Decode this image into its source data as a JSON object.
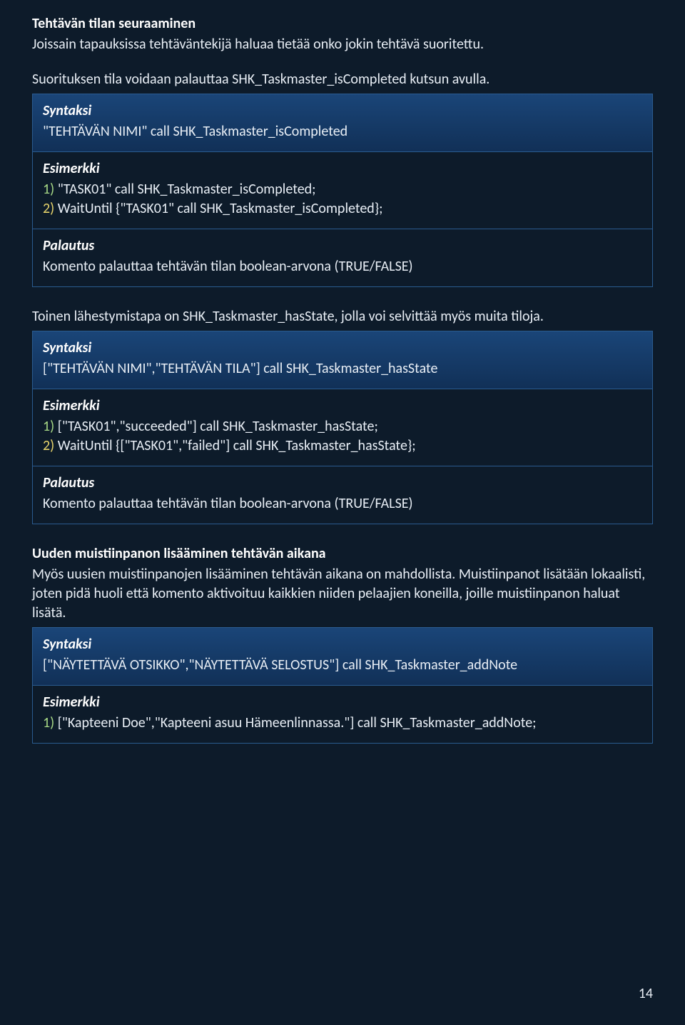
{
  "section1": {
    "heading": "Tehtävän tilan seuraaminen",
    "p1": "Joissain tapauksissa tehtäväntekijä haluaa tietää onko jokin tehtävä suoritettu.",
    "p2": "Suorituksen tila voidaan palauttaa SHK_Taskmaster_isCompleted kutsun avulla."
  },
  "box1": {
    "syntax_label": "Syntaksi",
    "syntax_body": "\"TEHTÄVÄN NIMI\" call SHK_Taskmaster_isCompleted",
    "example_label": "Esimerkki",
    "ex1_num": "1)",
    "ex1_body": " \"TASK01\" call SHK_Taskmaster_isCompleted;",
    "ex2_num": "2)",
    "ex2_body": " WaitUntil {\"TASK01\" call SHK_Taskmaster_isCompleted};",
    "return_label": "Palautus",
    "return_body": "Komento palauttaa tehtävän tilan boolean-arvona (TRUE/FALSE)"
  },
  "middle_p": "Toinen lähestymistapa on SHK_Taskmaster_hasState, jolla voi selvittää myös muita tiloja.",
  "box2": {
    "syntax_label": "Syntaksi",
    "syntax_body": "[\"TEHTÄVÄN NIMI\",\"TEHTÄVÄN TILA\"] call SHK_Taskmaster_hasState",
    "example_label": "Esimerkki",
    "ex1_num": "1)",
    "ex1_body": " [\"TASK01\",\"succeeded\"] call SHK_Taskmaster_hasState;",
    "ex2_num": "2)",
    "ex2_body": " WaitUntil {[\"TASK01\",\"failed\"] call SHK_Taskmaster_hasState};",
    "return_label": "Palautus",
    "return_body": "Komento palauttaa tehtävän tilan boolean-arvona (TRUE/FALSE)"
  },
  "section2": {
    "heading": "Uuden muistiinpanon lisääminen tehtävän aikana",
    "p1": "Myös uusien muistiinpanojen lisääminen tehtävän aikana on mahdollista. Muistiinpanot lisätään lokaalisti, joten pidä huoli että komento aktivoituu kaikkien niiden pelaajien koneilla, joille muistiinpanon haluat lisätä."
  },
  "box3": {
    "syntax_label": "Syntaksi",
    "syntax_body": "[\"NÄYTETTÄVÄ OTSIKKO\",\"NÄYTETTÄVÄ SELOSTUS\"] call SHK_Taskmaster_addNote",
    "example_label": "Esimerkki",
    "ex1_num": "1)",
    "ex1_body": " [\"Kapteeni Doe\",\"Kapteeni asuu Hämeenlinnassa.\"] call SHK_Taskmaster_addNote;"
  },
  "page_number": "14"
}
